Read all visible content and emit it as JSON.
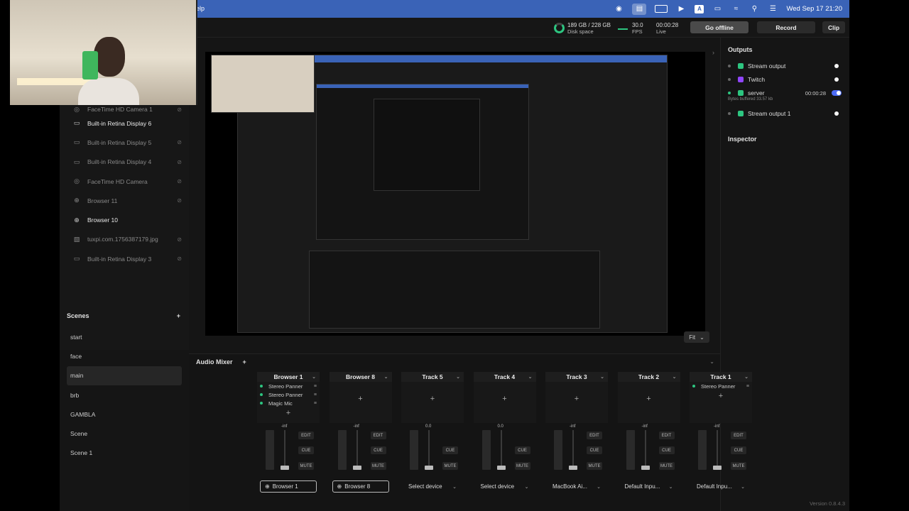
{
  "menubar": {
    "help_label": "elp",
    "datetime": "Wed Sep 17  21:20"
  },
  "topbar": {
    "disk_value": "189 GB / 228 GB",
    "disk_label": "Disk space",
    "fps_value": "30.0",
    "fps_label": "FPS",
    "live_time": "00:00:28",
    "live_label": "Live",
    "go_offline_label": "Go offline",
    "record_label": "Record",
    "clip_label": "Clip"
  },
  "sources": [
    {
      "label": "FaceTime HD Camera 1",
      "icon": "camera-icon",
      "active": false
    },
    {
      "label": "Built-in Retina Display 6",
      "icon": "monitor-icon",
      "active": true
    },
    {
      "label": "Built-in Retina Display 5",
      "icon": "monitor-icon",
      "active": false
    },
    {
      "label": "Built-in Retina Display 4",
      "icon": "monitor-icon",
      "active": false
    },
    {
      "label": "FaceTime HD Camera",
      "icon": "camera-icon",
      "active": false
    },
    {
      "label": "Browser 11",
      "icon": "globe-icon",
      "active": false
    },
    {
      "label": "Browser 10",
      "icon": "globe-icon",
      "active": true
    },
    {
      "label": "tuxpi.com.1756387179.jpg",
      "icon": "image-icon",
      "active": false
    },
    {
      "label": "Built-in Retina Display 3",
      "icon": "monitor-icon",
      "active": false
    }
  ],
  "scenes": {
    "title": "Scenes",
    "items": [
      "start",
      "face",
      "main",
      "brb",
      "GAMBLA",
      "Scene",
      "Scene 1"
    ],
    "active_index": 2
  },
  "preview": {
    "fit_label": "Fit"
  },
  "outputs": {
    "title": "Outputs",
    "items": [
      {
        "label": "Stream output",
        "color": "#2dc580",
        "status": "white"
      },
      {
        "label": "Twitch",
        "color": "#9146ff",
        "status": "white"
      },
      {
        "label": "server",
        "color": "#2dc580",
        "status": "toggle",
        "time": "00:00:28",
        "sub": "Bytes buffered  33.57 kb"
      },
      {
        "label": "Stream output 1",
        "color": "#2dc580",
        "status": "white"
      }
    ]
  },
  "inspector": {
    "title": "Inspector"
  },
  "mixer": {
    "title": "Audio Mixer",
    "edit": "EDIT",
    "cue": "CUE",
    "mute": "MUTE",
    "strips": [
      {
        "name": "Browser 1",
        "fx": [
          "Stereo Panner",
          "Stereo Panner",
          "Magic Mic"
        ],
        "db": "-inf",
        "device": "Browser 1",
        "boxed": true,
        "edit": true
      },
      {
        "name": "Browser 8",
        "fx": [],
        "db": "-inf",
        "device": "Browser 8",
        "boxed": true,
        "edit": true
      },
      {
        "name": "Track 5",
        "fx": [],
        "db": "0.0",
        "device": "Select device",
        "boxed": false,
        "edit": false
      },
      {
        "name": "Track 4",
        "fx": [],
        "db": "0.0",
        "device": "Select device",
        "boxed": false,
        "edit": false
      },
      {
        "name": "Track 3",
        "fx": [],
        "db": "-inf",
        "device": "MacBook Ai...",
        "boxed": false,
        "edit": true
      },
      {
        "name": "Track 2",
        "fx": [],
        "db": "-inf",
        "device": "Default Inpu...",
        "boxed": false,
        "edit": true
      },
      {
        "name": "Track 1",
        "fx": [
          "Stereo Panner"
        ],
        "db": "-inf",
        "device": "Default Inpu...",
        "boxed": false,
        "edit": true
      }
    ]
  },
  "version": "Version 0.8.4.3"
}
